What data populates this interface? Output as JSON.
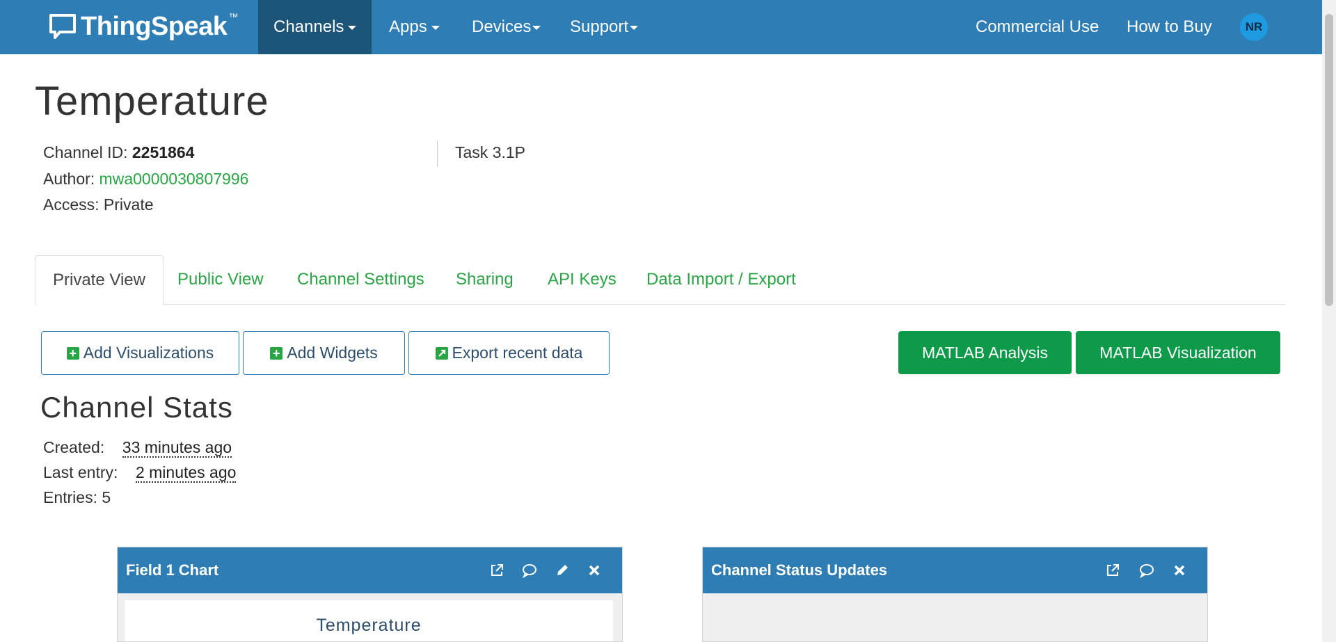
{
  "nav": {
    "brand": "ThingSpeak",
    "brand_tm": "™",
    "items": [
      {
        "label": "Channels",
        "dropdown": true,
        "active": true
      },
      {
        "label": "Apps",
        "dropdown": true
      },
      {
        "label": "Devices",
        "dropdown": true
      },
      {
        "label": "Support",
        "dropdown": true
      }
    ],
    "right_links": [
      "Commercial Use",
      "How to Buy"
    ],
    "avatar_initials": "NR"
  },
  "channel": {
    "title": "Temperature",
    "id_label": "Channel ID:",
    "id_value": "2251864",
    "author_label": "Author:",
    "author_value": "mwa0000030807996",
    "access_label": "Access:",
    "access_value": "Private",
    "description": "Task 3.1P"
  },
  "tabs": [
    "Private View",
    "Public View",
    "Channel Settings",
    "Sharing",
    "API Keys",
    "Data Import / Export"
  ],
  "buttons": {
    "add_visualizations": "Add Visualizations",
    "add_widgets": "Add Widgets",
    "export_recent": "Export recent data",
    "matlab_analysis": "MATLAB Analysis",
    "matlab_visualization": "MATLAB Visualization"
  },
  "stats": {
    "title": "Channel Stats",
    "created_label": "Created:",
    "created_value": "33 minutes ago",
    "last_entry_label": "Last entry:",
    "last_entry_value": "2 minutes ago",
    "entries_label": "Entries:",
    "entries_value": "5"
  },
  "panels": {
    "field1": {
      "title": "Field 1 Chart",
      "chart_title": "Temperature"
    },
    "status": {
      "title": "Channel Status Updates"
    }
  },
  "colors": {
    "navbar": "#2e7db5",
    "nav_active": "#1d5579",
    "link_green": "#2aa545",
    "button_green": "#0e9a49",
    "avatar": "#1e9be0"
  }
}
